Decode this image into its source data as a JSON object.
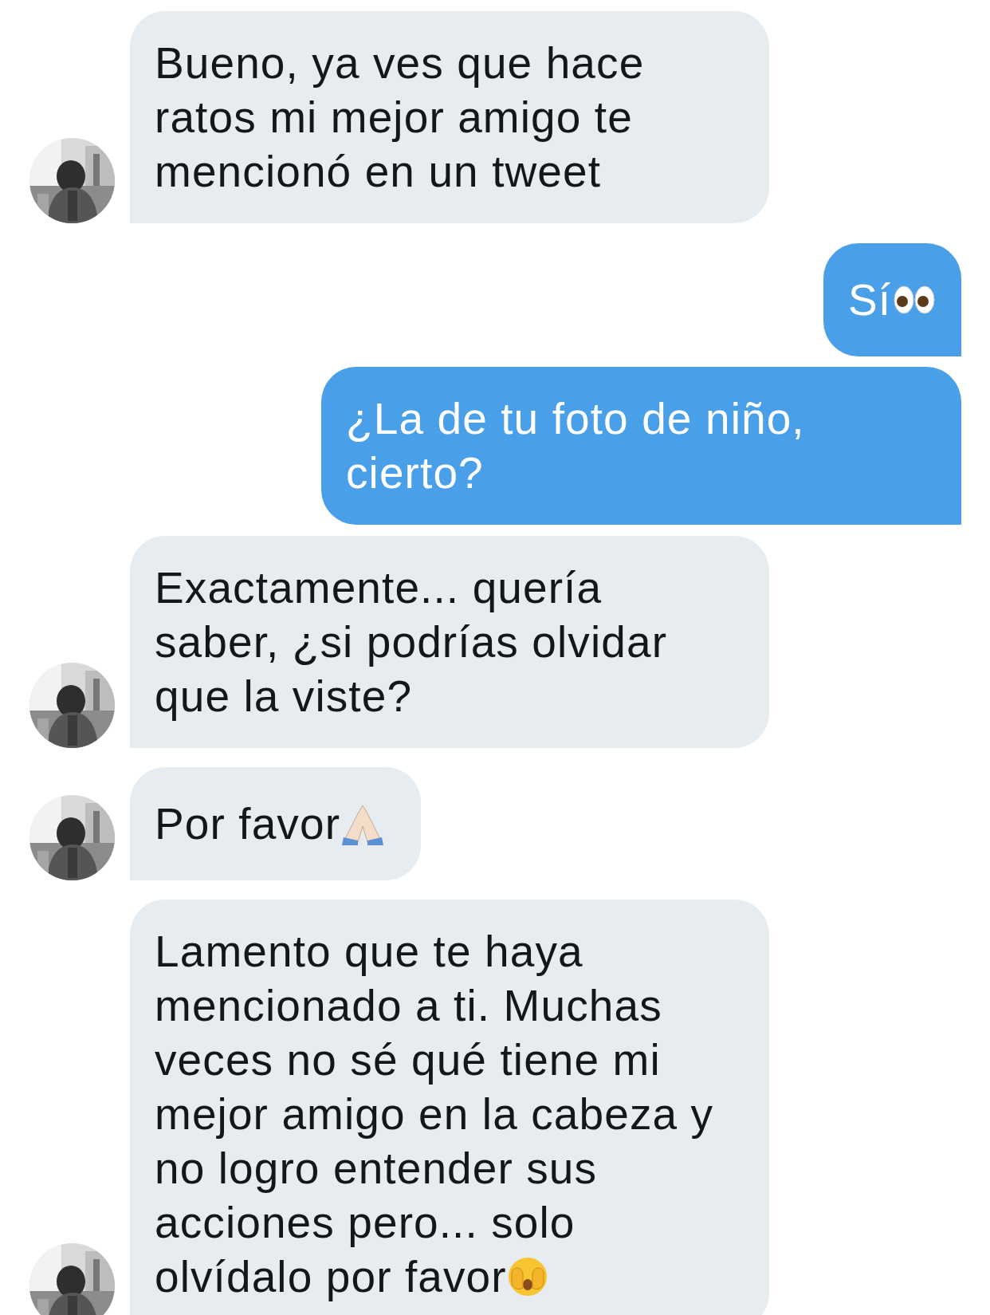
{
  "messages": [
    {
      "kind": "received",
      "lines": [
        "Bueno, ya ves que hace",
        "ratos mi mejor amigo te",
        "mencionó en un tweet"
      ]
    },
    {
      "kind": "sent",
      "lines": [
        "Sí"
      ],
      "icons": [
        {
          "kind": "eyes"
        }
      ]
    },
    {
      "kind": "sent",
      "lines": [
        "¿La de tu foto de niño,",
        "cierto?"
      ]
    },
    {
      "kind": "received",
      "lines": [
        "Exactamente... quería",
        "saber, ¿si podrías olvidar",
        "que la viste?"
      ]
    },
    {
      "kind": "received",
      "lines": [
        "Por favor"
      ],
      "icons": [
        {
          "kind": "praying-hands"
        }
      ]
    },
    {
      "kind": "received",
      "lines": [
        "Lamento que te haya",
        "mencionado a ti. Muchas",
        "veces no sé qué tiene mi",
        "mejor amigo en la cabeza y",
        "no logro entender sus",
        "acciones pero... solo",
        "olvídalo por favor"
      ],
      "icons": [
        {
          "kind": "face-hands"
        }
      ]
    }
  ]
}
